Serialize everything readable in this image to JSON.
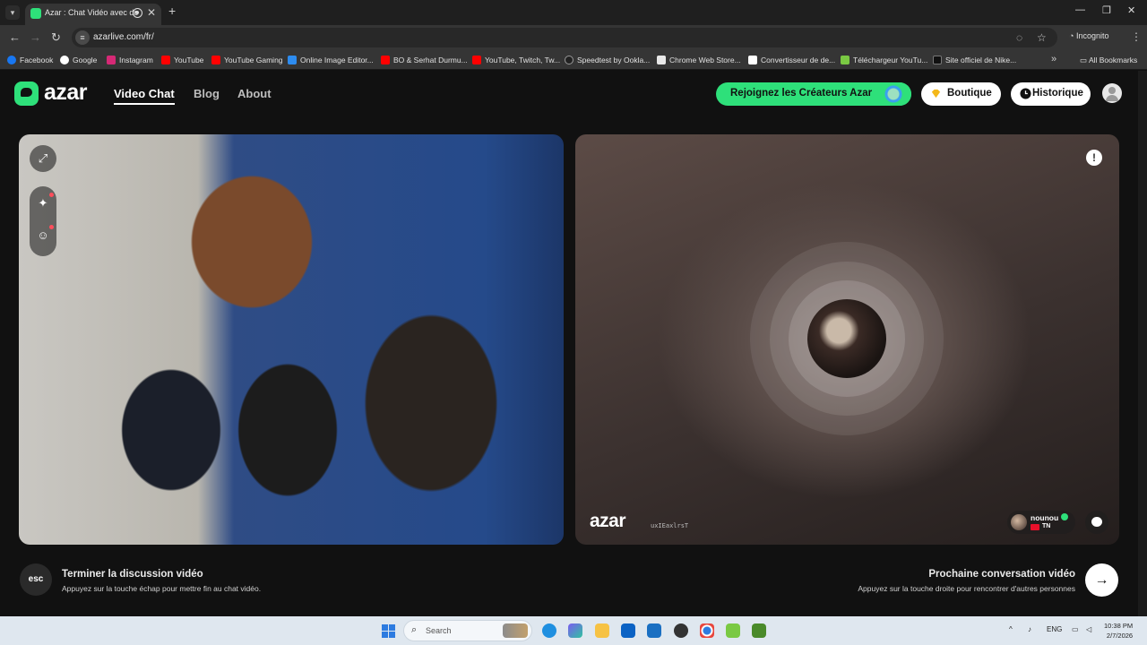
{
  "browser": {
    "tab_title": "Azar : Chat Vidéo avec de",
    "url": "azarlive.com/fr/",
    "incognito_label": "Incognito",
    "bookmarks": [
      {
        "label": "Facebook",
        "color": "#1877f2"
      },
      {
        "label": "Google",
        "color": "#ffffff"
      },
      {
        "label": "Instagram",
        "color": "#d62976"
      },
      {
        "label": "YouTube",
        "color": "#ff0000"
      },
      {
        "label": "YouTube Gaming",
        "color": "#ff0000"
      },
      {
        "label": "Online Image Editor...",
        "color": "#2d8cf0"
      },
      {
        "label": "BO & Serhat Durmu...",
        "color": "#ff0000"
      },
      {
        "label": "YouTube, Twitch, Tw...",
        "color": "#ff0000"
      },
      {
        "label": "Speedtest by Ookla...",
        "color": "#222222"
      },
      {
        "label": "Chrome Web Store...",
        "color": "#e8e8e8"
      },
      {
        "label": "Convertisseur de de...",
        "color": "#ffffff"
      },
      {
        "label": "Téléchargeur YouTu...",
        "color": "#7ac943"
      },
      {
        "label": "Site officiel de Nike...",
        "color": "#111111"
      }
    ],
    "all_bookmarks_label": "All Bookmarks"
  },
  "header": {
    "logo_text": "azar",
    "nav": [
      "Video Chat",
      "Blog",
      "About"
    ],
    "creators_button": "Rejoignez les Créateurs Azar",
    "shop_button": "Boutique",
    "history_button": "Historique"
  },
  "video": {
    "watermark_logo": "azar",
    "watermark_code": "uxIEaxlrsT",
    "partner_name": "nounou",
    "partner_country": "TN"
  },
  "hints": {
    "esc_key": "esc",
    "end_title": "Terminer la discussion vidéo",
    "end_sub": "Appuyez sur la touche échap pour mettre fin au chat vidéo.",
    "next_title": "Prochaine conversation vidéo",
    "next_sub": "Appuyez sur la touche droite pour rencontrer d'autres personnes"
  },
  "taskbar": {
    "search_placeholder": "Search",
    "language": "ENG",
    "time": "10:38 PM",
    "date": "2/7/2026"
  },
  "colors": {
    "accent": "#2ee07a",
    "background": "#111111"
  }
}
